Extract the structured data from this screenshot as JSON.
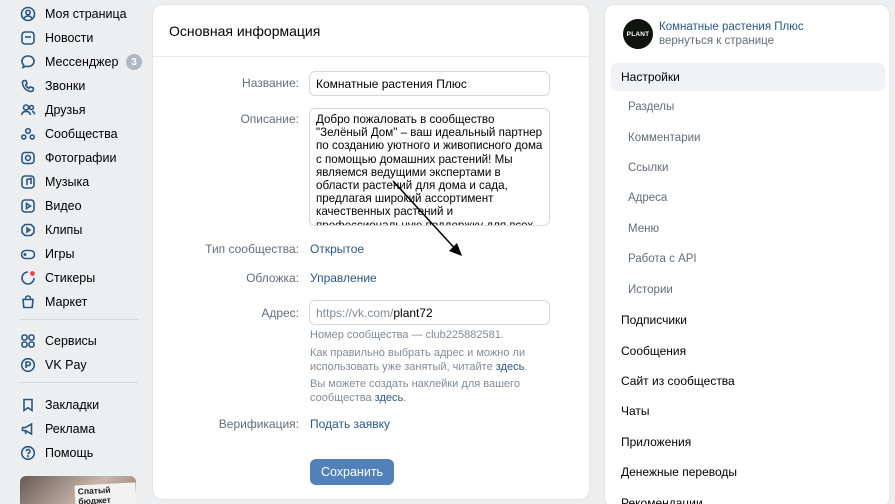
{
  "left_nav": {
    "items": [
      {
        "label": "Моя страница",
        "icon": "user-icon"
      },
      {
        "label": "Новости",
        "icon": "news-icon"
      },
      {
        "label": "Мессенджер",
        "icon": "chat-icon",
        "badge": "3"
      },
      {
        "label": "Звонки",
        "icon": "phone-icon"
      },
      {
        "label": "Друзья",
        "icon": "friends-icon"
      },
      {
        "label": "Сообщества",
        "icon": "communities-icon"
      },
      {
        "label": "Фотографии",
        "icon": "photo-icon"
      },
      {
        "label": "Музыка",
        "icon": "music-icon"
      },
      {
        "label": "Видео",
        "icon": "video-icon"
      },
      {
        "label": "Клипы",
        "icon": "clips-icon"
      },
      {
        "label": "Игры",
        "icon": "games-icon"
      },
      {
        "label": "Стикеры",
        "icon": "stickers-icon"
      },
      {
        "label": "Маркет",
        "icon": "market-icon"
      },
      {
        "label": "Сервисы",
        "icon": "services-icon"
      },
      {
        "label": "VK Pay",
        "icon": "vkpay-icon"
      },
      {
        "label": "Закладки",
        "icon": "bookmark-icon"
      },
      {
        "label": "Реклама",
        "icon": "ads-icon"
      },
      {
        "label": "Помощь",
        "icon": "help-icon"
      }
    ],
    "promo_text": "Спатый бюджет"
  },
  "main": {
    "title": "Основная информация",
    "name_label": "Название:",
    "name_value": "Комнатные растения Плюс",
    "desc_label": "Описание:",
    "desc_value": "Добро пожаловать в сообщество \"Зелёный Дом\" – ваш идеальный партнер по созданию уютного и живописного дома с помощью домашних растений! Мы являемся ведущими экспертами в области растений для дома и сада, предлагая широкий ассортимент качественных растений и профессиональную поддержку для всех любителей зелени.",
    "type_label": "Тип сообщества:",
    "type_value": "Открытое",
    "cover_label": "Обложка:",
    "cover_value": "Управление",
    "address_label": "Адрес:",
    "address_prefix": "https://vk.com/",
    "address_value": "plant72",
    "hint_number": "Номер сообщества — club225882581.",
    "hint_address": "Как правильно выбрать адрес и можно ли использовать уже занятый, читайте",
    "hint_address_link": "здесь",
    "hint_stickers": "Вы можете создать наклейки для вашего сообщества",
    "hint_stickers_link": "здесь",
    "verify_label": "Верификация:",
    "verify_value": "Подать заявку",
    "save_label": "Сохранить"
  },
  "side": {
    "avatar_text": "PLANT",
    "group_name": "Комнатные растения Плюс",
    "back_link": "вернуться к странице",
    "items": [
      {
        "label": "Настройки",
        "active": true,
        "sub": false
      },
      {
        "label": "Разделы",
        "sub": true
      },
      {
        "label": "Комментарии",
        "sub": true
      },
      {
        "label": "Ссылки",
        "sub": true
      },
      {
        "label": "Адреса",
        "sub": true
      },
      {
        "label": "Меню",
        "sub": true
      },
      {
        "label": "Работа с API",
        "sub": true
      },
      {
        "label": "Истории",
        "sub": true
      },
      {
        "label": "Подписчики",
        "sub": false
      },
      {
        "label": "Сообщения",
        "sub": false
      },
      {
        "label": "Сайт из сообщества",
        "sub": false
      },
      {
        "label": "Чаты",
        "sub": false
      },
      {
        "label": "Приложения",
        "sub": false
      },
      {
        "label": "Денежные переводы",
        "sub": false
      },
      {
        "label": "Рекомендации",
        "sub": false
      }
    ]
  },
  "colors": {
    "background": "#edeef0",
    "link": "#2a5885",
    "button": "#5181b8",
    "label": "#626d7a",
    "hint": "#818c99"
  }
}
